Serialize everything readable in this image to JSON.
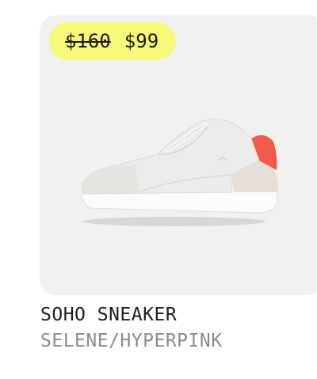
{
  "product": {
    "price_original": "$160",
    "price_sale": "$99",
    "name": "SOHO SNEAKER",
    "colorway": "SELENE/HYPERPINK",
    "image_icon": "sneaker-image"
  },
  "colors": {
    "badge": "#f6fa78",
    "card": "#f1f1f1",
    "name_text": "#1d1d1d",
    "color_text": "#8c8c8c",
    "shoe_upper": "#ececea",
    "shoe_accent": "#f25a4a",
    "shoe_heel": "#e6dfd6"
  }
}
